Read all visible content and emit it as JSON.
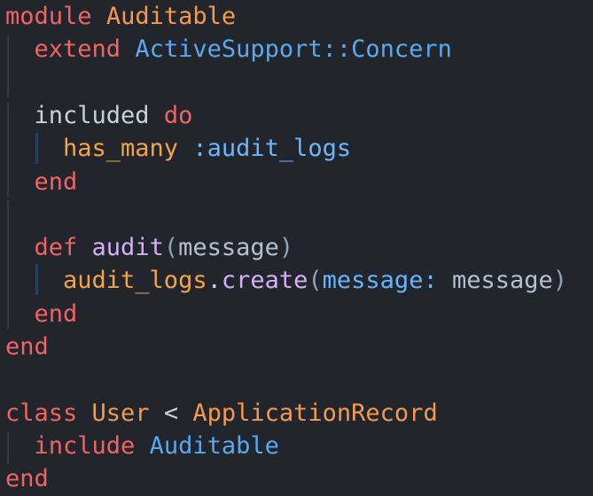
{
  "editor": {
    "lines": [
      [
        {
          "t": "module",
          "c": "kw"
        },
        {
          "t": " "
        },
        {
          "t": "Auditable",
          "c": "const"
        }
      ],
      [
        {
          "t": "  extend",
          "c": "kw"
        },
        {
          "t": " "
        },
        {
          "t": "ActiveSupport::Concern",
          "c": "cls"
        }
      ],
      [],
      [
        {
          "t": "  included",
          "c": "txt"
        },
        {
          "t": " "
        },
        {
          "t": "do",
          "c": "kw"
        }
      ],
      [
        {
          "t": "    has_many",
          "c": "call"
        },
        {
          "t": " "
        },
        {
          "t": ":audit_logs",
          "c": "sym"
        }
      ],
      [
        {
          "t": "  end",
          "c": "kw"
        }
      ],
      [],
      [
        {
          "t": "  def",
          "c": "kw"
        },
        {
          "t": " "
        },
        {
          "t": "audit",
          "c": "fn"
        },
        {
          "t": "(",
          "c": "punc"
        },
        {
          "t": "message",
          "c": "param"
        },
        {
          "t": ")",
          "c": "punc"
        }
      ],
      [
        {
          "t": "    audit_logs",
          "c": "call"
        },
        {
          "t": ".",
          "c": "txt"
        },
        {
          "t": "create",
          "c": "fn"
        },
        {
          "t": "(",
          "c": "punc"
        },
        {
          "t": "message: ",
          "c": "method"
        },
        {
          "t": "message",
          "c": "param"
        },
        {
          "t": ")",
          "c": "punc"
        }
      ],
      [
        {
          "t": "  end",
          "c": "kw"
        }
      ],
      [
        {
          "t": "end",
          "c": "kw"
        }
      ],
      [],
      [
        {
          "t": "class",
          "c": "kw"
        },
        {
          "t": " "
        },
        {
          "t": "User",
          "c": "const"
        },
        {
          "t": " < ",
          "c": "txt"
        },
        {
          "t": "ApplicationRecord",
          "c": "const"
        }
      ],
      [
        {
          "t": "  include",
          "c": "kw"
        },
        {
          "t": " "
        },
        {
          "t": "Auditable",
          "c": "cls"
        }
      ],
      [
        {
          "t": "end",
          "c": "kw"
        }
      ]
    ]
  }
}
